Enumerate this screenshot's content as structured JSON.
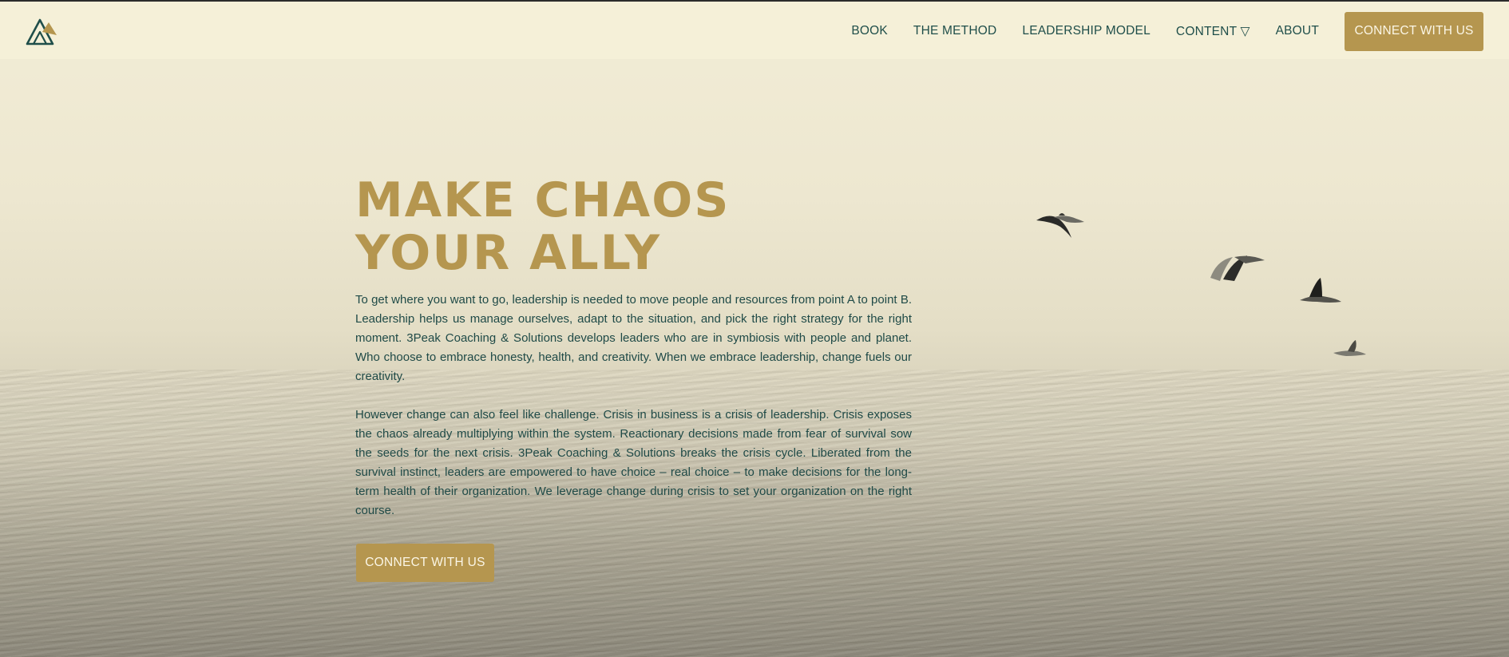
{
  "header": {
    "logo_icon": "triangle-peaks-logo",
    "nav": [
      {
        "label": "BOOK"
      },
      {
        "label": "THE METHOD"
      },
      {
        "label": "LEADERSHIP MODEL"
      },
      {
        "label": "CONTENT ▽"
      },
      {
        "label": "ABOUT"
      }
    ],
    "cta_label": "CONNECT WITH US"
  },
  "hero": {
    "headline_line1": "MAKE CHAOS",
    "headline_line2": "YOUR ALLY",
    "paragraph1": "To get where you want to go, leadership is needed to move people and resources from point A to point B. Leadership helps us manage ourselves, adapt to the situation, and pick the right strategy for the right moment. 3Peak Coaching & Solutions develops leaders who are in symbiosis with people and planet. Who choose to embrace honesty, health, and creativity. When we embrace leadership, change fuels our creativity.",
    "paragraph2": "However change can also feel like challenge. Crisis in business is a crisis of leadership. Crisis exposes the chaos already multiplying within the system. Reactionary decisions made from fear of survival sow the seeds for the next crisis. 3Peak Coaching & Solutions breaks the crisis cycle. Liberated from the survival instinct, leaders are empowered to have choice – real choice – to make decisions for the long-term health of their organization. We leverage change during crisis to set your organization on the right course.",
    "cta_label": "CONNECT WITH US",
    "background_image": "misty-sea-with-seagulls"
  },
  "colors": {
    "accent_gold": "#b5964f",
    "text_teal": "#1f4a47",
    "header_bg": "#f5f0d8"
  }
}
